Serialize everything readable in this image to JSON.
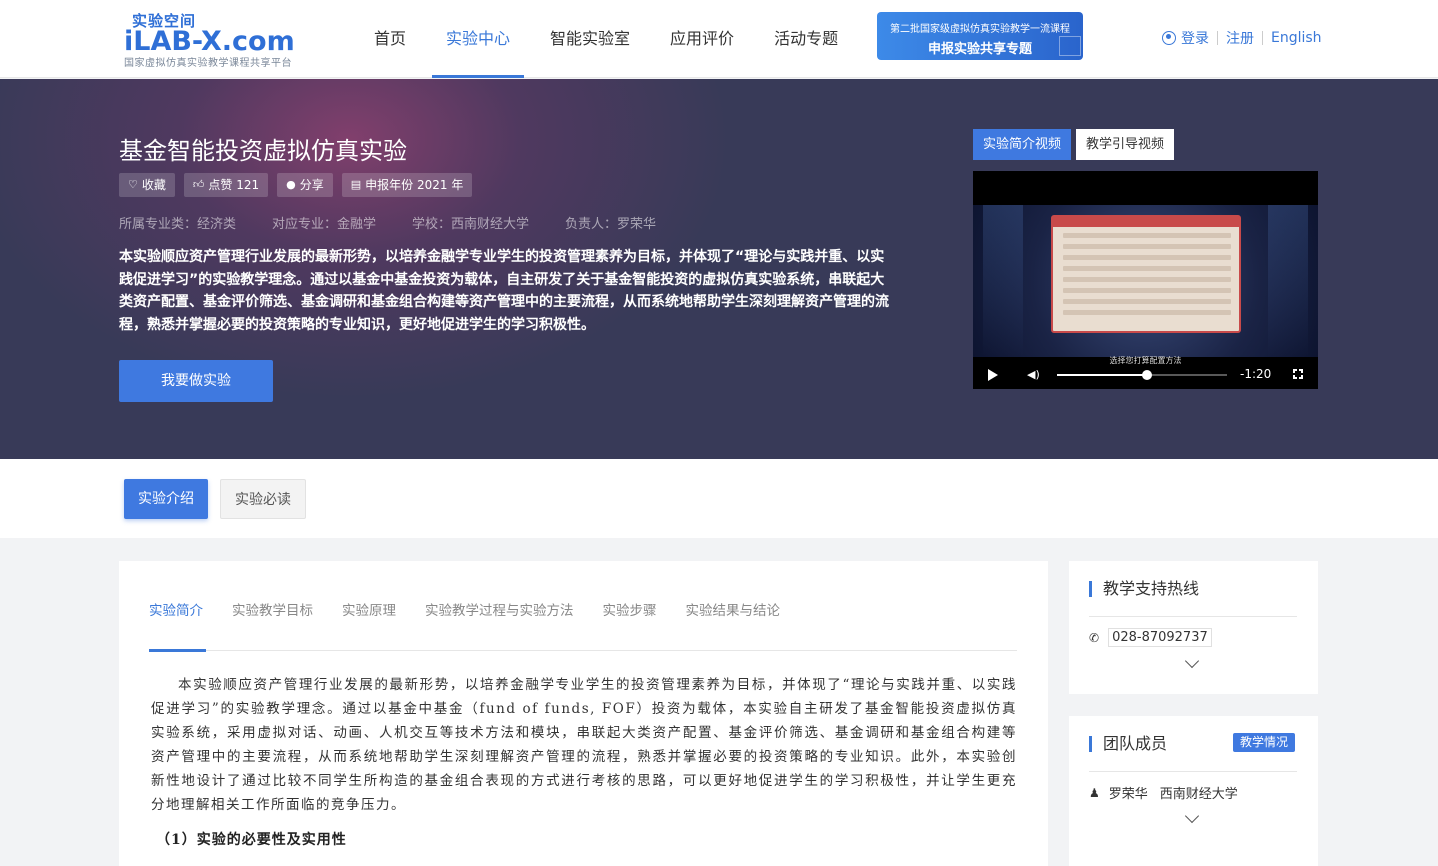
{
  "logo": {
    "cn_small": "实验空间",
    "big": "iLAB-X.com",
    "tagline": "国家虚拟仿真实验教学课程共享平台"
  },
  "nav": {
    "items": [
      {
        "label": "首页",
        "active": false
      },
      {
        "label": "实验中心",
        "active": true
      },
      {
        "label": "智能实验室",
        "active": false
      },
      {
        "label": "应用评价",
        "active": false
      },
      {
        "label": "活动专题",
        "active": false
      }
    ]
  },
  "promo": {
    "line1": "第二批国家级虚拟仿真实验教学一流课程",
    "line2": "申报实验共享专题"
  },
  "auth": {
    "login": "登录",
    "register": "注册",
    "language": "English"
  },
  "hero": {
    "title": "基金智能投资虚拟仿真实验",
    "chips": {
      "favorite": "收藏",
      "like": "点赞 121",
      "share": "分享",
      "year": "申报年份 2021 年"
    },
    "meta": {
      "category": "所属专业类：经济类",
      "major": "对应专业：金融学",
      "school": "学校：西南财经大学",
      "owner": "负责人：罗荣华"
    },
    "description": "本实验顺应资产管理行业发展的最新形势，以培养金融学专业学生的投资管理素养为目标，并体现了“理论与实践并重、以实践促进学习”的实验教学理念。通过以基金中基金投资为载体，自主研发了关于基金智能投资的虚拟仿真实验系统，串联起大类资产配置、基金评价筛选、基金调研和基金组合构建等资产管理中的主要流程，从而系统地帮助学生深刻理解资产管理的流程，熟悉并掌握必要的投资策略的专业知识，更好地促进学生的学习积极性。",
    "do_button": "我要做实验"
  },
  "video": {
    "tab_intro": "实验简介视频",
    "tab_guide": "教学引导视频",
    "time": "-1:20",
    "progress": 0.53,
    "caption": "选择您打算配置方法"
  },
  "subtabs": {
    "intro": "实验介绍",
    "must_read": "实验必读"
  },
  "content": {
    "tabs": [
      {
        "label": "实验简介",
        "active": true
      },
      {
        "label": "实验教学目标",
        "active": false
      },
      {
        "label": "实验原理",
        "active": false
      },
      {
        "label": "实验教学过程与实验方法",
        "active": false
      },
      {
        "label": "实验步骤",
        "active": false
      },
      {
        "label": "实验结果与结论",
        "active": false
      }
    ],
    "paragraph": "本实验顺应资产管理行业发展的最新形势，以培养金融学专业学生的投资管理素养为目标，并体现了“理论与实践并重、以实践促进学习”的实验教学理念。通过以基金中基金（fund of funds, FOF）投资为载体，本实验自主研发了基金智能投资虚拟仿真实验系统，采用虚拟对话、动画、人机交互等技术方法和模块，串联起大类资产配置、基金评价筛选、基金调研和基金组合构建等资产管理中的主要流程，从而系统地帮助学生深刻理解资产管理的流程，熟悉并掌握必要的投资策略的专业知识。此外，本实验创新性地设计了通过比较不同学生所构造的基金组合表现的方式进行考核的思路，可以更好地促进学生的学习积极性，并让学生更充分地理解相关工作所面临的竞争压力。",
    "subhead": "（1）实验的必要性及实用性"
  },
  "sidebar": {
    "hotline_title": "教学支持热线",
    "phone": "028-87092737",
    "team_title": "团队成员",
    "team_badge": "教学情况",
    "member": "罗荣华",
    "member_school": "西南财经大学"
  },
  "colors": {
    "brand": "#3a78d8",
    "button": "#3f79e0",
    "hero_bg": "#383a58"
  }
}
